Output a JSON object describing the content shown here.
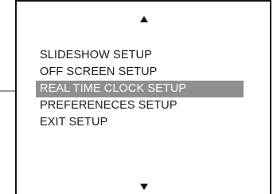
{
  "menu": {
    "items": [
      {
        "label": "SLIDESHOW SETUP",
        "selected": false
      },
      {
        "label": "OFF SCREEN SETUP",
        "selected": false
      },
      {
        "label": "REAL TIME CLOCK SETUP",
        "selected": true
      },
      {
        "label": "PREFERENECES SETUP",
        "selected": false
      },
      {
        "label": "EXIT SETUP",
        "selected": false
      }
    ]
  },
  "icons": {
    "scroll_up": "triangle-up-icon",
    "scroll_down": "triangle-down-icon",
    "pointer": "arrow-right-icon"
  },
  "colors": {
    "highlight": "#8f8f8f",
    "text": "#1a1a1a",
    "selected_text": "#ffffff",
    "pointer": "#9a9a9a",
    "frame": "#111111"
  }
}
